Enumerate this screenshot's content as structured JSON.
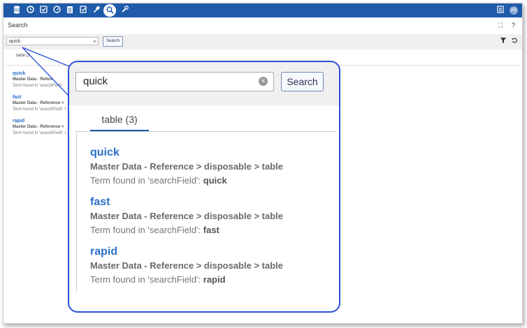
{
  "toolbar": {
    "icons": [
      "database-icon",
      "clock-icon",
      "checklist-icon",
      "dashboard-icon",
      "stack-icon",
      "edit-check-icon",
      "gavel-icon",
      "search-icon",
      "wrench-icon"
    ],
    "right_icons": [
      "report-icon"
    ],
    "avatar_initials": "AB"
  },
  "page": {
    "title": "Search",
    "header_actions": [
      "⛶",
      "?"
    ]
  },
  "search": {
    "value": "quick",
    "button_label": "Search"
  },
  "tabs": [
    {
      "label": "table (3)",
      "short_label": "table (3",
      "active": true
    }
  ],
  "results": [
    {
      "term": "quick",
      "path": "Master Data - Reference > disposable > table",
      "path_short": "Master Data - Refere",
      "found_prefix": "Term found in 'searchField': ",
      "found_short": "Term found in 'searchField",
      "found_value": "quick"
    },
    {
      "term": "fast",
      "path": "Master Data - Reference > disposable > table",
      "path_short": "Master Data - Reference >",
      "found_prefix": "Term found in 'searchField': ",
      "found_short": "Term found in 'searchField': f",
      "found_value": "fast"
    },
    {
      "term": "rapid",
      "path": "Master Data - Reference > disposable > table",
      "path_short": "Master Data - Reference >",
      "found_prefix": "Term found in 'searchField': ",
      "found_short": "Term found in 'searchField': r",
      "found_value": "rapid"
    }
  ],
  "colors": {
    "brand": "#1f5ba8",
    "link": "#2a6fc9",
    "callout": "#2b4fd8"
  }
}
